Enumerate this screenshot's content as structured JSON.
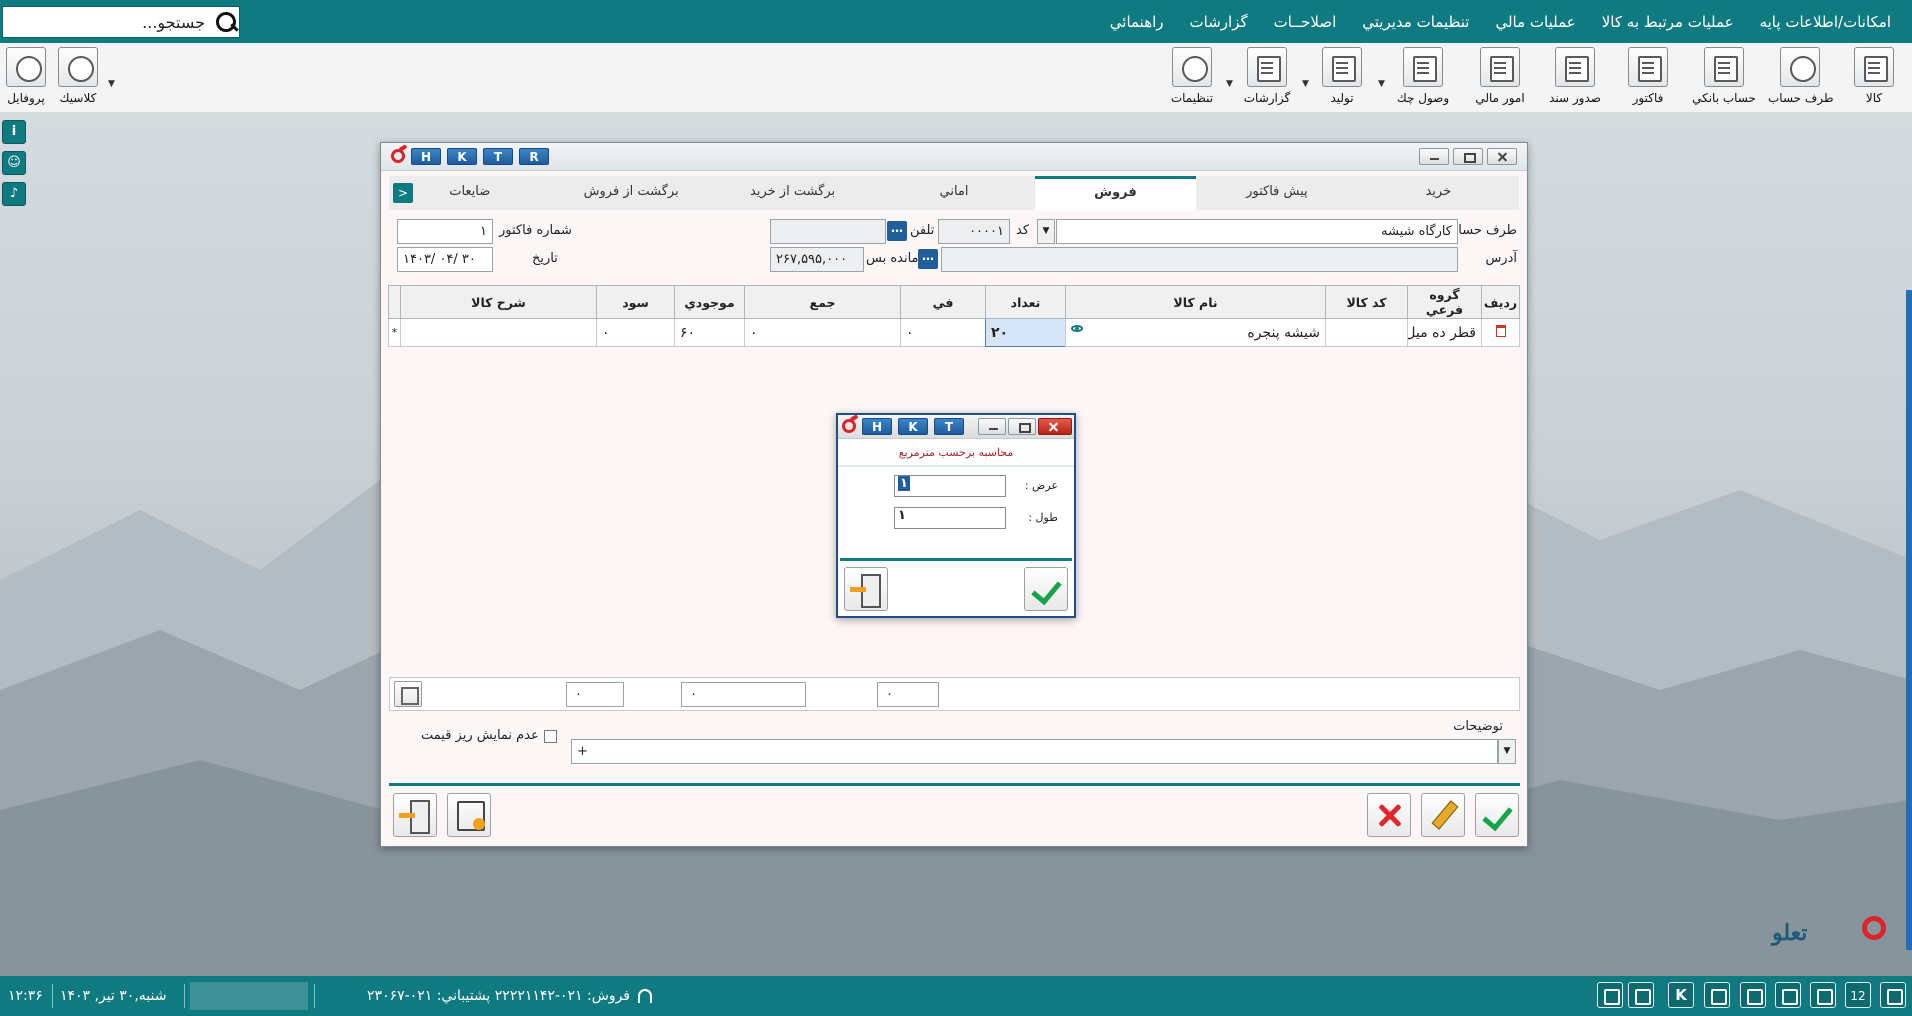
{
  "menu": {
    "items": [
      "امکانات/اطلاعات پايه",
      "عمليات مرتبط به کالا",
      "عمليات مالي",
      "تنظيمات مديريتي",
      "اصلاحــات",
      "گزارشات",
      "راهنمائي"
    ],
    "search_placeholder": "جستجو..."
  },
  "toolbar": {
    "items": [
      "کالا",
      "طرف حساب",
      "حساب بانکي",
      "فاکتور",
      "صدور سند",
      "امور مالي",
      "وصول چك",
      "توليد",
      "گزارشات",
      "تنظيمات"
    ],
    "left_items": [
      "کلاسيك",
      "پروفايل"
    ]
  },
  "window": {
    "title_letters": [
      "H",
      "K",
      "T",
      "R"
    ],
    "tabs": [
      "خريد",
      "پيش فاکتور",
      "فروش",
      "اماني",
      "برگشت از خريد",
      "برگشت از فروش",
      "ضايعات"
    ],
    "active_tab": "فروش",
    "form": {
      "account_label": "طرف حساب",
      "account_value": "کارگاه شيشه",
      "code_label": "کد",
      "code_value": "۰۰۰۰۱",
      "phone_label": "تلفن",
      "phone_value": "",
      "invoice_no_label": "شماره فاکتور",
      "invoice_no_value": "۱",
      "address_label": "آدرس",
      "address_value": "",
      "balance_label": "مانده بس",
      "balance_value": "۲۶۷,۵۹۵,۰۰۰",
      "date_label": "تاريخ",
      "date_value": "۱۴۰۳/ ۰۴/ ۳۰"
    },
    "grid": {
      "headers": [
        "رديف",
        "گروه فرعي",
        "کد کالا",
        "نام کالا",
        "تعداد",
        "في",
        "جمع",
        "موجودي",
        "سود",
        "شرح کالا"
      ],
      "rows": [
        {
          "subgroup": "قطر ده ميل",
          "code": "",
          "name": "شيشه پنجره",
          "qty": "۲۰",
          "price": "۰",
          "sum": "۰",
          "stock": "۶۰",
          "profit": "۰",
          "desc": ""
        }
      ],
      "star": "*"
    },
    "totals": {
      "qty": "۰",
      "sum": "۰",
      "profit": "۰"
    },
    "description_label": "توضيحات",
    "description_value": "+",
    "hide_price_detail_label": "عدم نمايش ريز قيمت"
  },
  "dialog": {
    "title_letters": [
      "H",
      "K",
      "T"
    ],
    "heading": "محاسبه برحسب مترمربع",
    "width_label": "عرض :",
    "width_value": "۱",
    "length_label": "طول :",
    "length_value": "۱"
  },
  "status": {
    "datetime": "شنبه,۳۰ تير, ۱۴۰۳",
    "time": "۱۲:۳۶",
    "sales_phone": "فروش:  ۰۲۱-۲۲۲۲۱۱۴۲  پشتيباني:  ۰۲۱-۲۳۰۶۷",
    "calendar_day": "12",
    "k_letter": "K"
  },
  "brand": {
    "name": "تعلو"
  },
  "colors": {
    "teal": "#0f7a80",
    "blue": "#1f5f9e",
    "red": "#d9252a",
    "green": "#17a34a"
  }
}
